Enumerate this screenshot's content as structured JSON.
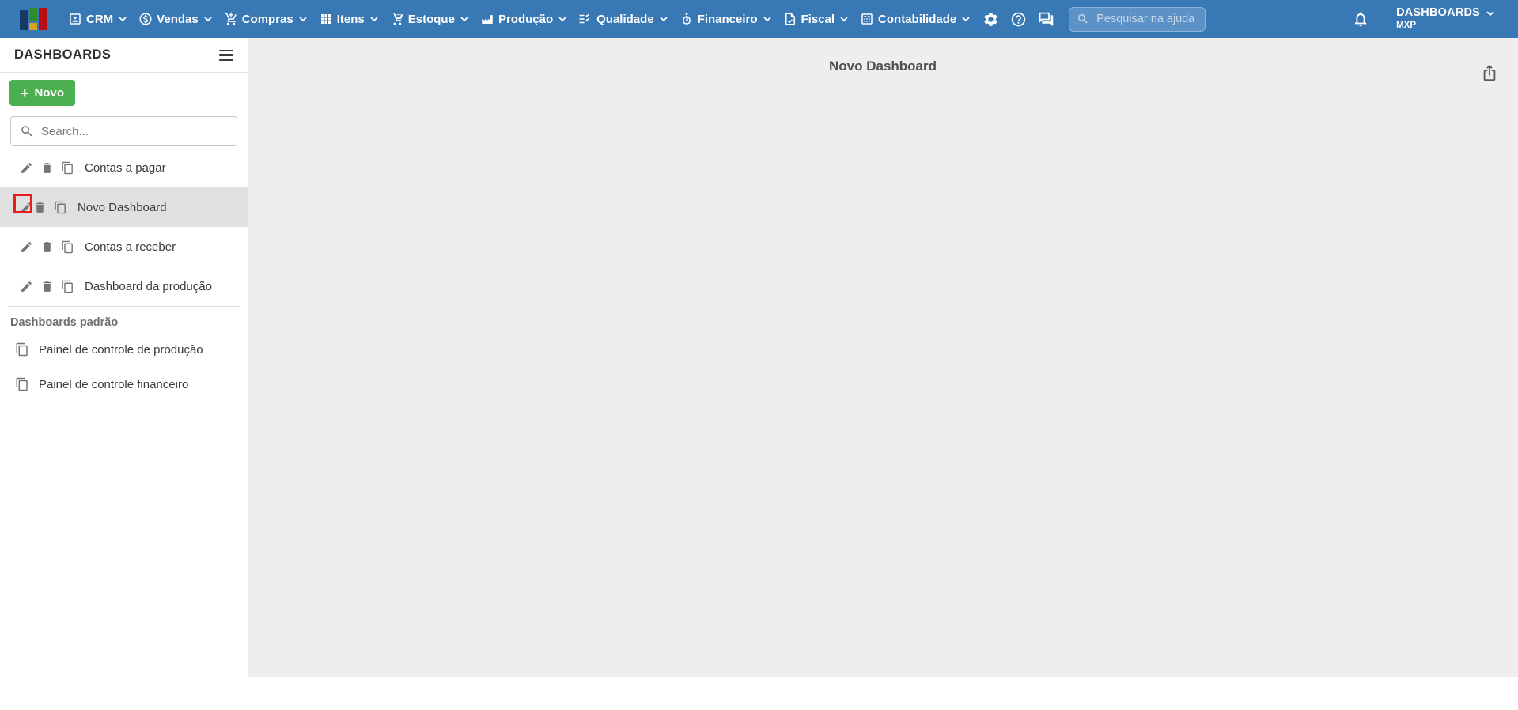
{
  "topbar": {
    "menus": [
      {
        "label": "CRM",
        "icon": "crm-icon"
      },
      {
        "label": "Vendas",
        "icon": "sales-icon"
      },
      {
        "label": "Compras",
        "icon": "purchases-icon"
      },
      {
        "label": "Itens",
        "icon": "items-icon"
      },
      {
        "label": "Estoque",
        "icon": "stock-icon"
      },
      {
        "label": "Produção",
        "icon": "production-icon"
      },
      {
        "label": "Qualidade",
        "icon": "quality-icon"
      },
      {
        "label": "Financeiro",
        "icon": "finance-icon"
      },
      {
        "label": "Fiscal",
        "icon": "fiscal-icon"
      },
      {
        "label": "Contabilidade",
        "icon": "accounting-icon"
      }
    ],
    "action_icons": [
      "settings-icon",
      "help-icon",
      "chat-icon"
    ],
    "help_search": {
      "placeholder": "Pesquisar na ajuda"
    },
    "notification_icon": "bell-icon",
    "account": {
      "name": "DASHBOARDS",
      "company": "MXP"
    }
  },
  "sidebar": {
    "title": "DASHBOARDS",
    "new_button": {
      "plus": "+",
      "label": "Novo"
    },
    "search": {
      "placeholder": "Search..."
    },
    "dashboards": [
      {
        "label": "Contas a pagar",
        "selected": false,
        "actions": [
          "edit-icon",
          "delete-icon",
          "duplicate-icon"
        ]
      },
      {
        "label": "Novo Dashboard",
        "selected": true,
        "edit_highlighted": true,
        "actions": [
          "edit-icon",
          "delete-icon",
          "duplicate-icon"
        ]
      },
      {
        "label": "Contas a receber",
        "selected": false,
        "actions": [
          "edit-icon",
          "delete-icon",
          "duplicate-icon"
        ]
      },
      {
        "label": "Dashboard da produção",
        "selected": false,
        "actions": [
          "edit-icon",
          "delete-icon",
          "duplicate-icon"
        ]
      }
    ],
    "default_section": {
      "title": "Dashboards padrão",
      "items": [
        {
          "label": "Painel de controle de produção",
          "actions": [
            "duplicate-icon"
          ]
        },
        {
          "label": "Painel de controle financeiro",
          "actions": [
            "duplicate-icon"
          ]
        }
      ]
    }
  },
  "main": {
    "title": "Novo Dashboard",
    "share_icon": "share-icon"
  },
  "colors": {
    "topbar_blue": "#3878b5",
    "new_button_green": "#4caf50",
    "selected_row_gray": "#e0e0e0",
    "annotation_red": "#e81d1d",
    "canvas_gray": "#eeeeee"
  }
}
